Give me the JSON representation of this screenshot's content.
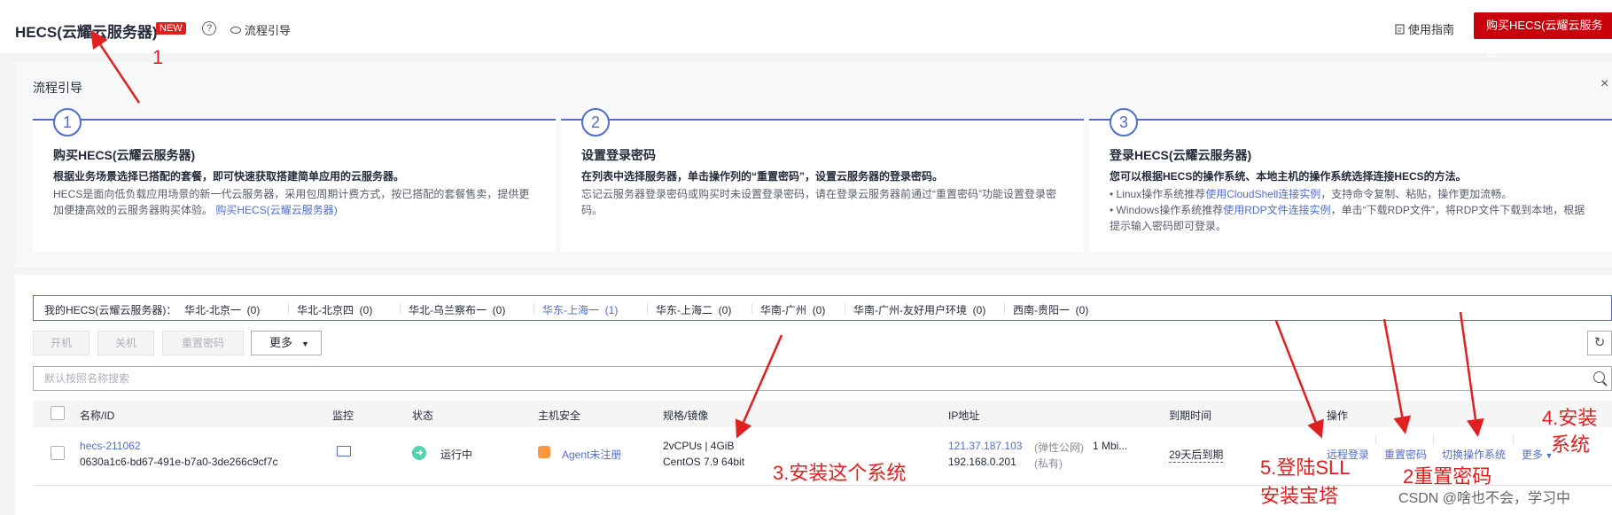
{
  "header": {
    "title": "HECS(云耀云服务器)",
    "new_badge": "NEW",
    "help_glyph": "?",
    "flow_link": "流程引导",
    "manual_link": "使用指南",
    "buy_button": "购买HECS(云耀云服务器)"
  },
  "flow": {
    "title": "流程引导",
    "close_glyph": "×",
    "steps": [
      {
        "num": "1",
        "heading": "购买HECS(云耀云服务器)",
        "subheading": "根据业务场景选择已搭配的套餐，即可快速获取搭建简单应用的云服务器。",
        "text": "HECS是面向低负载应用场景的新一代云服务器，采用包周期计费方式，按已搭配的套餐售卖，提供更加便捷高效的云服务器购买体验。",
        "link": "购买HECS(云耀云服务器)"
      },
      {
        "num": "2",
        "heading": "设置登录密码",
        "subheading": "在列表中选择服务器，单击操作列的“重置密码”，设置云服务器的登录密码。",
        "text": "忘记云服务器登录密码或购买时未设置登录密码，请在登录云服务器前通过“重置密码”功能设置登录密码。"
      },
      {
        "num": "3",
        "heading": "登录HECS(云耀云服务器)",
        "subheading": "您可以根据HECS的操作系统、本地主机的操作系统选择连接HECS的方法。",
        "bullet1_pre": "Linux操作系统推荐",
        "bullet1_link": "使用CloudShell连接实例",
        "bullet1_post": "，支持命令复制、粘贴，操作更加流畅。",
        "bullet2_pre": "Windows操作系统推荐",
        "bullet2_link": "使用RDP文件连接实例",
        "bullet2_post": "，单击“下载RDP文件”，将RDP文件下载到本地，根据提示输入密码即可登录。"
      }
    ]
  },
  "regions": {
    "label": "我的HECS(云耀云服务器)：",
    "items": [
      {
        "name": "华北-北京一",
        "count": "(0)"
      },
      {
        "name": "华北-北京四",
        "count": "(0)"
      },
      {
        "name": "华北-乌兰察布一",
        "count": "(0)"
      },
      {
        "name": "华东-上海一",
        "count": "(1)"
      },
      {
        "name": "华东-上海二",
        "count": "(0)"
      },
      {
        "name": "华南-广州",
        "count": "(0)"
      },
      {
        "name": "华南-广州-友好用户环境",
        "count": "(0)"
      },
      {
        "name": "西南-贵阳一",
        "count": "(0)"
      }
    ]
  },
  "toolbar": {
    "start": "开机",
    "stop": "关机",
    "reset_pwd": "重置密码",
    "more": "更多",
    "refresh_glyph": "↻"
  },
  "search": {
    "placeholder": "默认按照名称搜索"
  },
  "table": {
    "headers": [
      "名称/ID",
      "监控",
      "状态",
      "主机安全",
      "规格/镜像",
      "IP地址",
      "到期时间",
      "操作"
    ],
    "row": {
      "name": "hecs-211062",
      "id": "0630a1c6-bd67-491e-b7a0-3de266c9cf7c",
      "status": "运行中",
      "security": "Agent未注册",
      "spec": "2vCPUs | 4GiB",
      "image": "CentOS 7.9 64bit",
      "ip_public": "121.37.187.103",
      "ip_public_type": "(弹性公网)",
      "bandwidth": "1 Mbi...",
      "ip_private": "192.168.0.201",
      "ip_private_type": "(私有)",
      "expire": "29天后到期",
      "ops": [
        "远程登录",
        "重置密码",
        "切换操作系统",
        "更多"
      ]
    }
  },
  "annotations": {
    "a1": "1",
    "a2": "2重置密码",
    "a3": "3.安装这个系统",
    "a4_line1": "4.安装",
    "a4_line2": "系统",
    "a5_line1": "5.登陆SLL",
    "a5_line2": "安装宝塔"
  },
  "watermark": "CSDN @啥也不会，学习中",
  "colors": {
    "brand_red": "#c7000b",
    "link_blue": "#526ecc",
    "annotation_red": "#e02020"
  }
}
